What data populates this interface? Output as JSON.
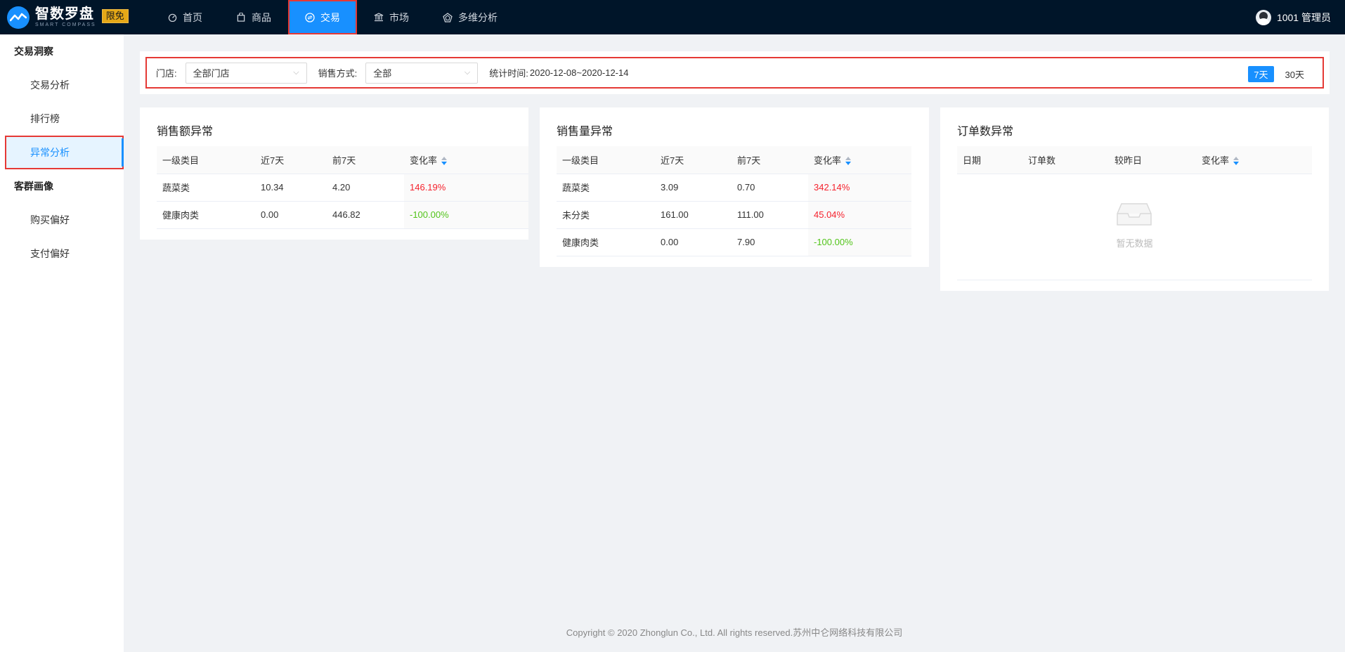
{
  "app": {
    "title": "智数罗盘",
    "subtitle": "SMART COMPASS",
    "badge": "限免"
  },
  "nav": {
    "items": [
      {
        "label": "首页",
        "icon": "dashboard-icon"
      },
      {
        "label": "商品",
        "icon": "bag-icon"
      },
      {
        "label": "交易",
        "icon": "exchange-icon",
        "active": true
      },
      {
        "label": "市场",
        "icon": "bank-icon"
      },
      {
        "label": "多维分析",
        "icon": "radar-icon"
      }
    ]
  },
  "user": {
    "label": "1001 管理员"
  },
  "sidebar": {
    "groups": [
      {
        "title": "交易洞察",
        "items": [
          "交易分析",
          "排行榜",
          "异常分析"
        ]
      },
      {
        "title": "客群画像",
        "items": [
          "购买偏好",
          "支付偏好"
        ]
      }
    ]
  },
  "filter": {
    "store_label": "门店:",
    "store_value": "全部门店",
    "method_label": "销售方式:",
    "method_value": "全部",
    "date_label": "统计时间:",
    "date_value": "2020-12-08~2020-12-14",
    "range_7": "7天",
    "range_30": "30天"
  },
  "cards": {
    "sales": {
      "title": "销售额异常",
      "headers": [
        "一级类目",
        "近7天",
        "前7天",
        "变化率"
      ],
      "rows": [
        [
          "蔬菜类",
          "10.34",
          "4.20",
          "146.19%"
        ],
        [
          "健康肉类",
          "0.00",
          "446.82",
          "-100.00%"
        ]
      ]
    },
    "volume": {
      "title": "销售量异常",
      "headers": [
        "一级类目",
        "近7天",
        "前7天",
        "变化率"
      ],
      "rows": [
        [
          "蔬菜类",
          "3.09",
          "0.70",
          "342.14%"
        ],
        [
          "未分类",
          "161.00",
          "111.00",
          "45.04%"
        ],
        [
          "健康肉类",
          "0.00",
          "7.90",
          "-100.00%"
        ]
      ]
    },
    "orders": {
      "title": "订单数异常",
      "headers": [
        "日期",
        "订单数",
        "较昨日",
        "变化率"
      ],
      "empty_text": "暂无数据"
    }
  },
  "colors": {
    "accent": "#1890ff",
    "positive": "#f5222d",
    "negative": "#52c41a",
    "highlight": "#e53935"
  },
  "footer": "Copyright © 2020 Zhonglun Co., Ltd. All rights reserved.苏州中仑网络科技有限公司"
}
